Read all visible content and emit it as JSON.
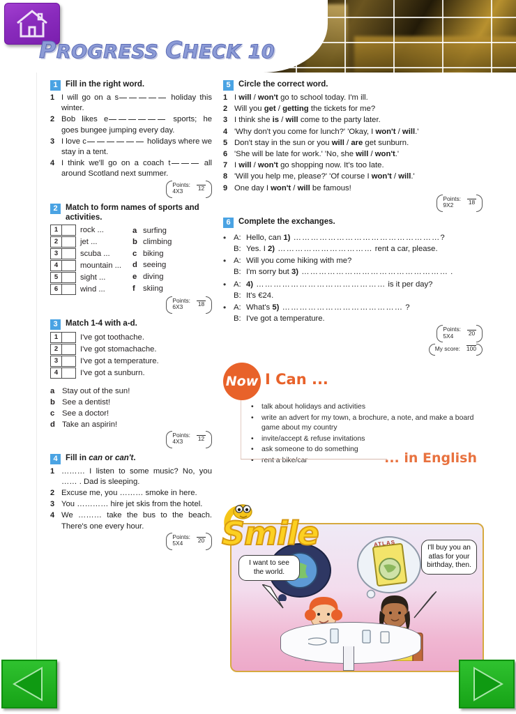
{
  "header": {
    "home_icon": "home-icon",
    "title_main": "ROGRESS",
    "title_cap1": "P",
    "title_cap2": "C",
    "title_rest": "HECK",
    "title_number": "10",
    "full_title": "PROGRESS CHECK 10"
  },
  "exercises": [
    {
      "number": "1",
      "title": "Fill in the right word.",
      "items": [
        {
          "n": "1",
          "pre": "I will go on a s",
          "blanks": 5,
          "post": "holiday this winter."
        },
        {
          "n": "2",
          "pre": "Bob likes e",
          "blanks": 6,
          "post": "sports; he goes bungee jumping every day."
        },
        {
          "n": "3",
          "pre": "I love c",
          "blanks": 6,
          "post": "holidays where we stay in a tent."
        },
        {
          "n": "4",
          "pre": "I think we'll go on a coach t",
          "blanks": 3,
          "post": "all around Scotland next summer."
        }
      ],
      "points": {
        "label": "Points:",
        "calc": "4X3",
        "total": "12"
      }
    },
    {
      "number": "2",
      "title": "Match to form names of sports and activities.",
      "left_items": [
        {
          "n": "1",
          "text": "rock ..."
        },
        {
          "n": "2",
          "text": "jet ..."
        },
        {
          "n": "3",
          "text": "scuba ..."
        },
        {
          "n": "4",
          "text": "mountain ..."
        },
        {
          "n": "5",
          "text": "sight ..."
        },
        {
          "n": "6",
          "text": "wind ..."
        }
      ],
      "right_items": [
        {
          "l": "a",
          "text": "surfing"
        },
        {
          "l": "b",
          "text": "climbing"
        },
        {
          "l": "c",
          "text": "biking"
        },
        {
          "l": "d",
          "text": "seeing"
        },
        {
          "l": "e",
          "text": "diving"
        },
        {
          "l": "f",
          "text": "skiing"
        }
      ],
      "points": {
        "label": "Points:",
        "calc": "6X3",
        "total": "18"
      }
    },
    {
      "number": "3",
      "title": "Match 1-4 with a-d.",
      "numbered": [
        {
          "n": "1",
          "text": "I've got toothache."
        },
        {
          "n": "2",
          "text": "I've got stomachache."
        },
        {
          "n": "3",
          "text": "I've got a temperature."
        },
        {
          "n": "4",
          "text": "I've got a sunburn."
        }
      ],
      "lettered": [
        {
          "l": "a",
          "text": "Stay out of the sun!"
        },
        {
          "l": "b",
          "text": "See a dentist!"
        },
        {
          "l": "c",
          "text": "See a doctor!"
        },
        {
          "l": "d",
          "text": "Take an aspirin!"
        }
      ],
      "points": {
        "label": "Points:",
        "calc": "4X3",
        "total": "12"
      }
    },
    {
      "number": "4",
      "title_pre": "Fill in ",
      "title_em1": "can",
      "title_mid": " or ",
      "title_em2": "can't",
      "title_post": ".",
      "items": [
        {
          "n": "1",
          "text": "……… I listen to some music? No, you …… . Dad is sleeping."
        },
        {
          "n": "2",
          "text": "Excuse me, you ……… smoke in here."
        },
        {
          "n": "3",
          "text": "You ………… hire jet skis from the hotel."
        },
        {
          "n": "4",
          "text": "We ……… take the bus to the beach. There's one every hour."
        }
      ],
      "points": {
        "label": "Points:",
        "calc": "5X4",
        "total": "20"
      }
    },
    {
      "number": "5",
      "title": "Circle the correct word.",
      "items": [
        {
          "n": "1",
          "parts": [
            "I ",
            "will",
            " / ",
            "won't",
            " go to school today. I'm ill."
          ]
        },
        {
          "n": "2",
          "parts": [
            "Will you ",
            "get",
            " / ",
            "getting",
            " the tickets for me?"
          ]
        },
        {
          "n": "3",
          "parts": [
            "I think she ",
            "is",
            " / ",
            "will",
            " come to the party later."
          ]
        },
        {
          "n": "4",
          "parts": [
            "'Why don't you come for lunch?' 'Okay, I ",
            "won't",
            " / ",
            "will",
            ".'"
          ]
        },
        {
          "n": "5",
          "parts": [
            "Don't stay in the sun or you ",
            "will",
            " / ",
            "are",
            " get sunburn."
          ]
        },
        {
          "n": "6",
          "parts": [
            "'She will be late for work.' 'No, she ",
            "will",
            " / ",
            "won't",
            ".'"
          ]
        },
        {
          "n": "7",
          "parts": [
            "I ",
            "will",
            " / ",
            "won't",
            " go shopping now. It's too late."
          ]
        },
        {
          "n": "8",
          "parts": [
            "'Will you help me, please?' 'Of course I ",
            "won't",
            " / ",
            "will",
            ".'"
          ]
        },
        {
          "n": "9",
          "parts": [
            "One day I ",
            "won't",
            " / ",
            "will",
            " be famous!"
          ]
        }
      ],
      "points": {
        "label": "Points:",
        "calc": "9X2",
        "total": "18"
      }
    },
    {
      "number": "6",
      "title": "Complete the exchanges.",
      "groups": [
        {
          "lines": [
            {
              "sp": "A:",
              "pre": "Hello, can ",
              "num": "1)",
              "dots": " ……………………………………………",
              "post": "?"
            },
            {
              "sp": "B:",
              "pre": "Yes. I ",
              "num": "2)",
              "dots": " ……………………………",
              "post": " rent a car, please."
            }
          ]
        },
        {
          "lines": [
            {
              "sp": "A:",
              "pre": "Will you come hiking with me?",
              "num": "",
              "dots": "",
              "post": ""
            },
            {
              "sp": "B:",
              "pre": "I'm sorry but ",
              "num": "3)",
              "dots": " ……………………………………………",
              "post": " ."
            }
          ]
        },
        {
          "lines": [
            {
              "sp": "A:",
              "pre": "",
              "num": "4)",
              "dots": " ………………………………………",
              "post": " is it per day?"
            },
            {
              "sp": "B:",
              "pre": "It's €24.",
              "num": "",
              "dots": "",
              "post": ""
            }
          ]
        },
        {
          "lines": [
            {
              "sp": "A:",
              "pre": "What's ",
              "num": "5)",
              "dots": " ……………………………………",
              "post": " ?"
            },
            {
              "sp": "B:",
              "pre": "I've got a temperature.",
              "num": "",
              "dots": "",
              "post": ""
            }
          ]
        }
      ],
      "points": {
        "label": "Points:",
        "calc": "5X4",
        "total": "20"
      }
    }
  ],
  "my_score": {
    "label": "My score:",
    "total": "100"
  },
  "now_i_can": {
    "badge": "Now",
    "heading": "I Can ...",
    "footer": "... in English",
    "items": [
      "talk about holidays and activities",
      "write an advert for my town, a brochure, a note, and make a board game about my country",
      "invite/accept & refuse invitations",
      "ask someone to do something",
      "rent a bike/car"
    ]
  },
  "smile": {
    "logo": "Smile",
    "bubble_left": "I want to see the world.",
    "bubble_right": "I'll buy you an atlas for your birthday, then.",
    "thought_left_icon": "globe-icon",
    "thought_right_label": "ATLAS"
  },
  "nav": {
    "prev_label": "previous-page",
    "next_label": "next-page"
  },
  "colors": {
    "accent_blue": "#4aa3e3",
    "accent_orange": "#e8622a",
    "title_blue": "#8c9bd6",
    "home_purple": "#8a2bbd",
    "nav_green": "#2fc22f",
    "smile_yellow": "#fcd021"
  }
}
